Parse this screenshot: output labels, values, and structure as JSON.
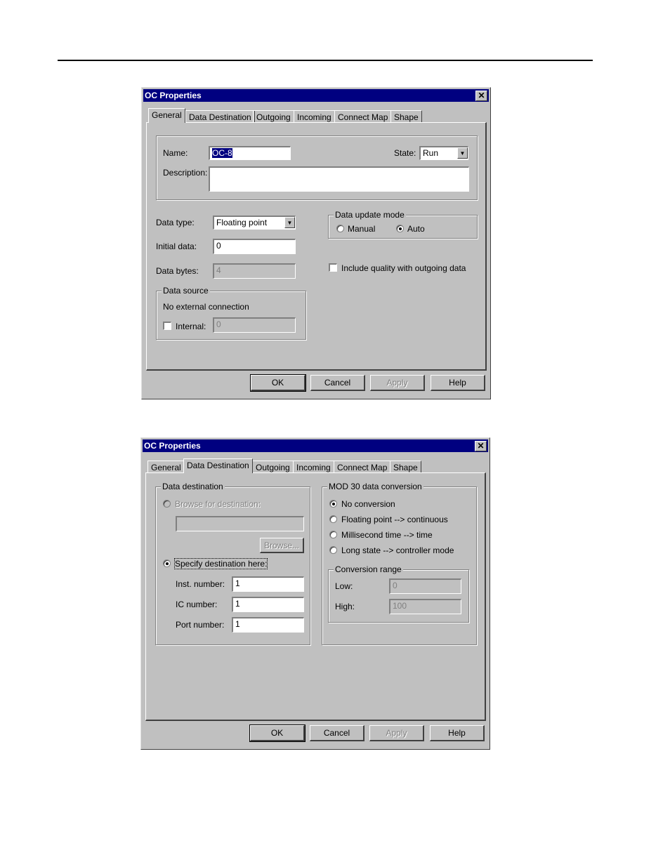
{
  "dialog1": {
    "title": "OC Properties",
    "close": "✕",
    "tabs": [
      "General",
      "Data Destination",
      "Outgoing",
      "Incoming",
      "Connect Map",
      "Shape"
    ],
    "name_label": "Name:",
    "name_value": "OC-8",
    "state_label": "State:",
    "state_value": "Run",
    "description_label": "Description:",
    "description_value": "",
    "data_type_label": "Data type:",
    "data_type_value": "Floating point",
    "initial_data_label": "Initial data:",
    "initial_data_value": "0",
    "data_bytes_label": "Data bytes:",
    "data_bytes_value": "4",
    "update_mode_group": "Data update mode",
    "manual_label": "Manual",
    "auto_label": "Auto",
    "include_quality_label": "Include quality with outgoing data",
    "data_source_group": "Data source",
    "data_source_text": "No external connection",
    "internal_label": "Internal:",
    "internal_value": "0"
  },
  "dialog2": {
    "title": "OC Properties",
    "close": "✕",
    "tabs": [
      "General",
      "Data Destination",
      "Outgoing",
      "Incoming",
      "Connect Map",
      "Shape"
    ],
    "dest_group": "Data destination",
    "browse_radio_label": "Browse for destination:",
    "browse_value": "",
    "browse_button": "Browse...",
    "specify_radio_label": "Specify destination here:",
    "inst_label": "Inst. number:",
    "inst_value": "1",
    "ic_label": "IC number:",
    "ic_value": "1",
    "port_label": "Port number:",
    "port_value": "1",
    "conversion_group": "MOD 30 data conversion",
    "no_conversion": "No conversion",
    "float_cont": "Floating point --> continuous",
    "ms_time": "Millisecond time --> time",
    "long_state": "Long state --> controller mode",
    "range_group": "Conversion range",
    "low_label": "Low:",
    "low_value": "0",
    "high_label": "High:",
    "high_value": "100"
  },
  "buttons": {
    "ok": "OK",
    "cancel": "Cancel",
    "apply": "Apply",
    "help": "Help"
  }
}
